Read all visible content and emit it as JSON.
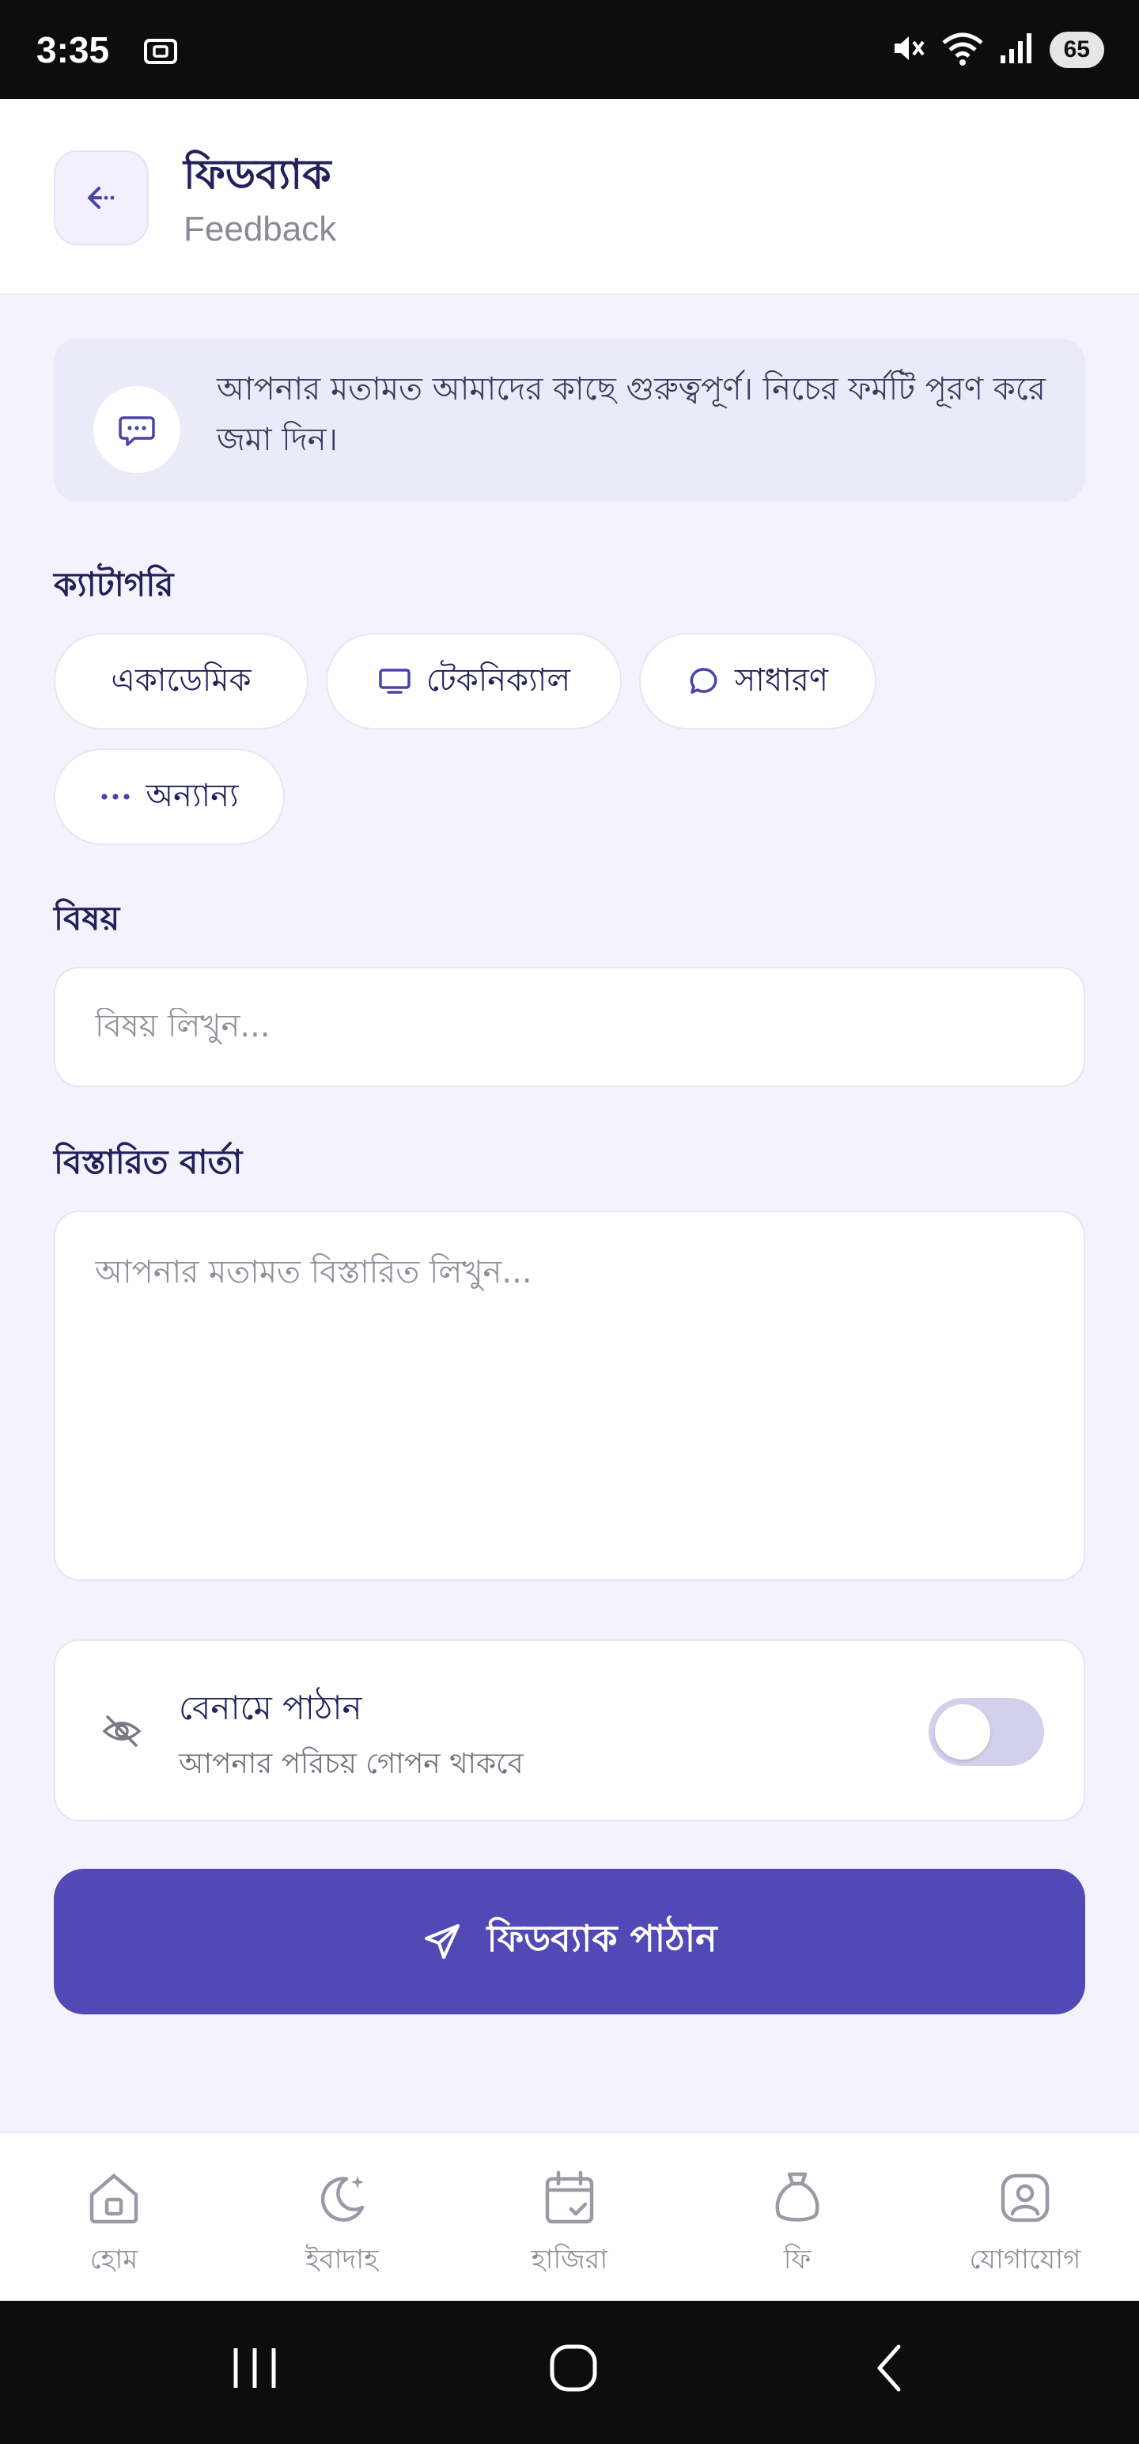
{
  "status_bar": {
    "time": "3:35",
    "battery": "65"
  },
  "header": {
    "title": "ফিডব্যাক",
    "subtitle": "Feedback"
  },
  "info": {
    "text": "আপনার মতামত আমাদের কাছে গুরুত্বপূর্ণ। নিচের ফর্মটি পূরণ করে জমা দিন।",
    "icon": "message-dots-icon"
  },
  "category": {
    "label": "ক্যাটাগরি",
    "chips": [
      {
        "label": "একাডেমিক",
        "icon": ""
      },
      {
        "label": "টেকনিক্যাল",
        "icon": "monitor-icon"
      },
      {
        "label": "সাধারণ",
        "icon": "chat-bubble-icon"
      },
      {
        "label": "অন্যান্য",
        "icon": "more-dots-icon"
      }
    ]
  },
  "subject": {
    "label": "বিষয়",
    "placeholder": "বিষয় লিখুন...",
    "value": ""
  },
  "message": {
    "label": "বিস্তারিত বার্তা",
    "placeholder": "আপনার মতামত বিস্তারিত লিখুন...",
    "value": ""
  },
  "anonymous": {
    "title": "বেনামে পাঠান",
    "subtitle": "আপনার পরিচয় গোপন থাকবে",
    "enabled": false
  },
  "submit": {
    "label": "ফিডব্যাক পাঠান"
  },
  "bottom_nav": [
    {
      "label": "হোম",
      "icon": "home-icon"
    },
    {
      "label": "ইবাদাহ",
      "icon": "moon-star-icon"
    },
    {
      "label": "হাজিরা",
      "icon": "calendar-check-icon"
    },
    {
      "label": "ফি",
      "icon": "money-bag-icon"
    },
    {
      "label": "যোগাযোগ",
      "icon": "contact-icon"
    }
  ],
  "colors": {
    "primary": "#5149b5",
    "background": "#f3f2fd",
    "text_dark": "#23205a"
  }
}
